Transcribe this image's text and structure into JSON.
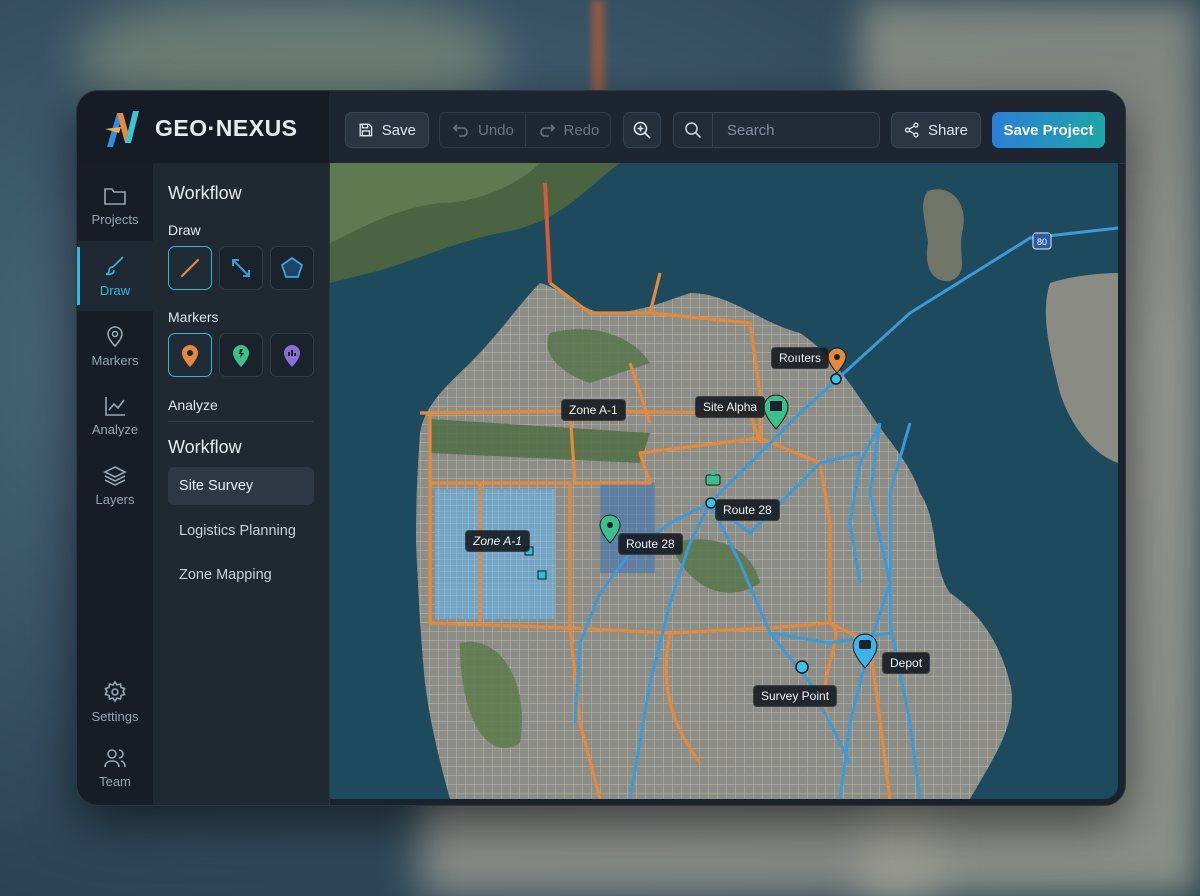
{
  "app": {
    "name": "GEO·NEXUS"
  },
  "toolbar": {
    "save_label": "Save",
    "undo_label": "Undo",
    "redo_label": "Redo",
    "search_placeholder": "Search",
    "share_label": "Share",
    "save_project_label": "Save Project"
  },
  "rail": {
    "projects": "Projects",
    "draw": "Draw",
    "markers": "Markers",
    "analyze": "Analyze",
    "layers": "Layers",
    "settings": "Settings",
    "team": "Team"
  },
  "panel": {
    "title": "Workflow",
    "draw_heading": "Draw",
    "markers_heading": "Markers",
    "analyze_heading": "Analyze",
    "workflow_heading": "Workflow",
    "workflow_items": [
      "Site Survey",
      "Logistics Planning",
      "Zone Mapping"
    ]
  },
  "map": {
    "labels": {
      "routers": "Roııters",
      "zone_a1_top": "Zone A-1",
      "site_alpha": "Site Alpha",
      "route28_right": "Route 28",
      "zone_a1_left": "Zone A-1",
      "route28_left": "Route 28",
      "depot": "Depot",
      "survey_point": "Survey Point",
      "highway_shield": "80"
    }
  },
  "colors": {
    "accent": "#34b9d8",
    "primary_gradient_start": "#2b7fd6",
    "primary_gradient_end": "#1fa5a9",
    "route_orange": "#e58a3c",
    "route_blue": "#3c9ad8",
    "marker_green": "#3cbf8a",
    "marker_purple": "#8a6fd6"
  }
}
